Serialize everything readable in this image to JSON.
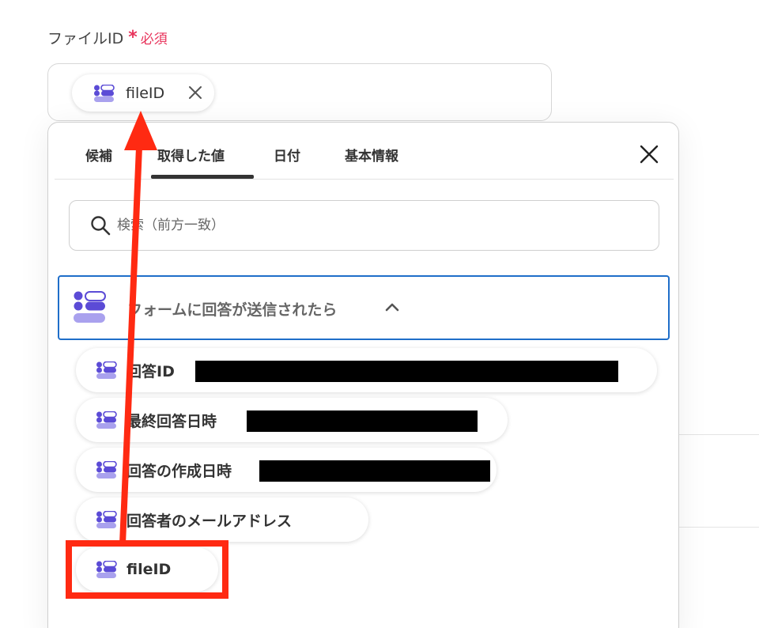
{
  "field": {
    "label": "ファイルID",
    "required_star": "*",
    "required_text": "必須",
    "chip_label": "fileID"
  },
  "picker": {
    "tabs": [
      {
        "label": "候補"
      },
      {
        "label": "取得した値"
      },
      {
        "label": "日付"
      },
      {
        "label": "基本情報"
      }
    ],
    "active_tab": "取得した値",
    "search_placeholder": "検索（前方一致）",
    "group_title": "フォームに回答が送信されたら",
    "items": [
      {
        "label": "回答ID"
      },
      {
        "label": "最終回答日時"
      },
      {
        "label": "回答の作成日時"
      },
      {
        "label": "回答者のメールアドレス"
      },
      {
        "label": "fileID"
      }
    ]
  },
  "colors": {
    "required": "#e8345c",
    "group_border": "#1f6ec9",
    "annotation": "#ff2a12",
    "icon_dark": "#5b4bd6",
    "icon_light": "#a9a1ee"
  }
}
